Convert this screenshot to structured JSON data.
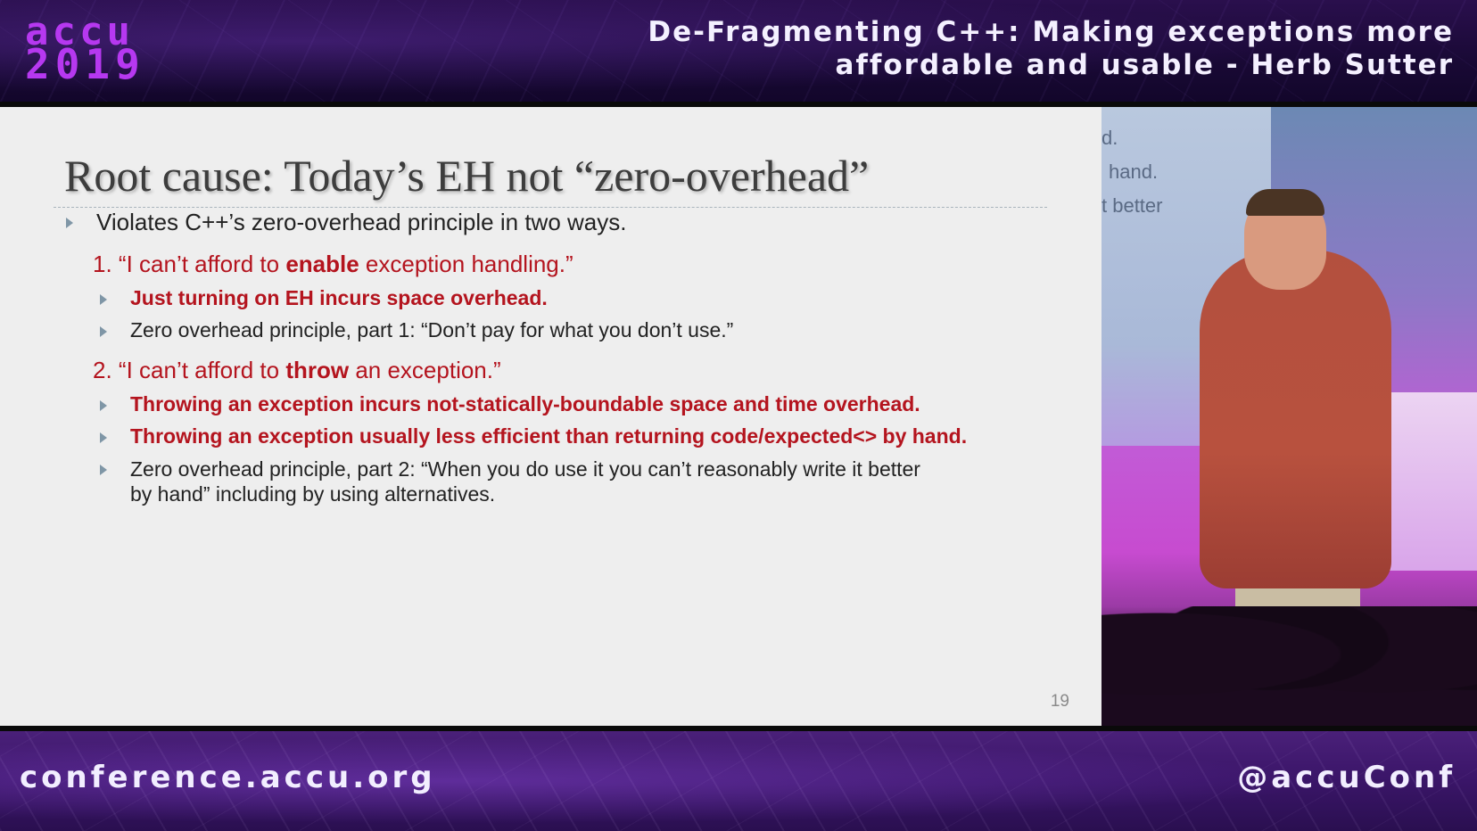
{
  "banner": {
    "logo_line1": "accu",
    "logo_line2": "2019",
    "talk_title_line1": "De-Fragmenting C++: Making exceptions more",
    "talk_title_line2": "affordable and usable - Herb Sutter"
  },
  "slide": {
    "title": "Root cause: Today’s EH not “zero-overhead”",
    "bullet_main": "Violates C++’s zero-overhead principle in two ways.",
    "item1": {
      "num": "1.",
      "pre": "“I can’t afford to ",
      "bold": "enable",
      "post": " exception handling.”"
    },
    "item1_sub1": "Just turning on EH incurs space overhead.",
    "item1_sub2": "Zero overhead principle, part 1: “Don’t pay for what you don’t use.”",
    "item2": {
      "num": "2.",
      "pre": "“I can’t afford to ",
      "bold": "throw",
      "post": " an exception.”"
    },
    "item2_sub1": "Throwing an exception incurs not-statically-boundable space and time overhead.",
    "item2_sub2": "Throwing an exception usually less efficient than returning code/expected<> by hand.",
    "item2_sub3_line1": "Zero overhead principle, part 2: “When you do use it you can’t reasonably write it better",
    "item2_sub3_line2": "by hand” including by using alternatives.",
    "page_number": "19"
  },
  "video": {
    "ghost_line1": "d.",
    "ghost_line2": "hand.",
    "ghost_line3": "t better"
  },
  "footer": {
    "url": "conference.accu.org",
    "handle": "@accuConf"
  },
  "colors": {
    "accent_purple": "#b638f0",
    "slide_red": "#b4141e",
    "slide_bg": "#eeeeee"
  }
}
